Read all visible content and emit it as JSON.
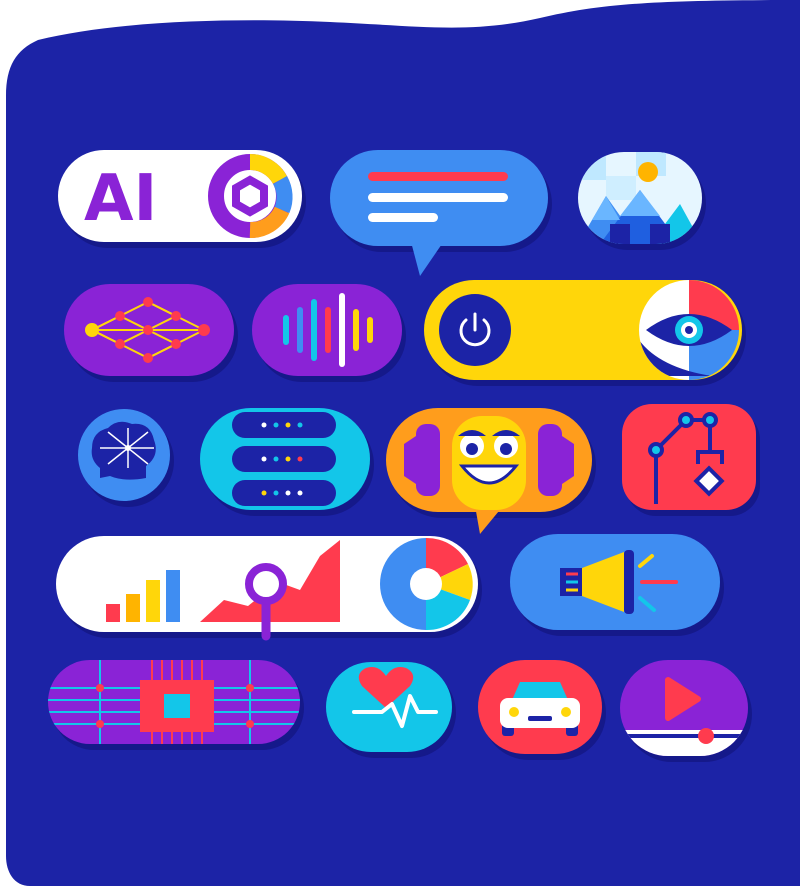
{
  "panel": {
    "color": "#1c23a6"
  },
  "ai_pill": {
    "text": "AI"
  },
  "palette": {
    "purple": "#8a23d6",
    "violet": "#6d1bd8",
    "blue": "#3f8df2",
    "cyan": "#13c6e9",
    "yellow": "#ffd60a",
    "orange": "#ff9d1c",
    "red": "#ff3b4e",
    "white": "#ffffff",
    "navy": "#19209a"
  },
  "tiles": [
    {
      "name": "ai-badge-pill",
      "icon": "ai-logo-icon"
    },
    {
      "name": "chat-bubble-tile",
      "icon": "chat-bubble-icon"
    },
    {
      "name": "image-tile",
      "icon": "mountain-image-icon"
    },
    {
      "name": "neural-network-tile",
      "icon": "neural-network-icon"
    },
    {
      "name": "sound-wave-tile",
      "icon": "sound-wave-icon"
    },
    {
      "name": "power-eye-toggle",
      "icon": "power-icon"
    },
    {
      "name": "brain-tile",
      "icon": "brain-icon"
    },
    {
      "name": "server-stack-tile",
      "icon": "server-icon"
    },
    {
      "name": "robot-face-bubble",
      "icon": "robot-face-icon"
    },
    {
      "name": "robot-arm-tile",
      "icon": "robot-arm-icon"
    },
    {
      "name": "analytics-pill",
      "icon": "bar-chart-icon"
    },
    {
      "name": "megaphone-tile",
      "icon": "megaphone-icon"
    },
    {
      "name": "circuit-chip-tile",
      "icon": "chip-icon"
    },
    {
      "name": "heartbeat-tile",
      "icon": "heart-pulse-icon"
    },
    {
      "name": "car-tile",
      "icon": "car-icon"
    },
    {
      "name": "video-player-tile",
      "icon": "play-icon"
    }
  ]
}
